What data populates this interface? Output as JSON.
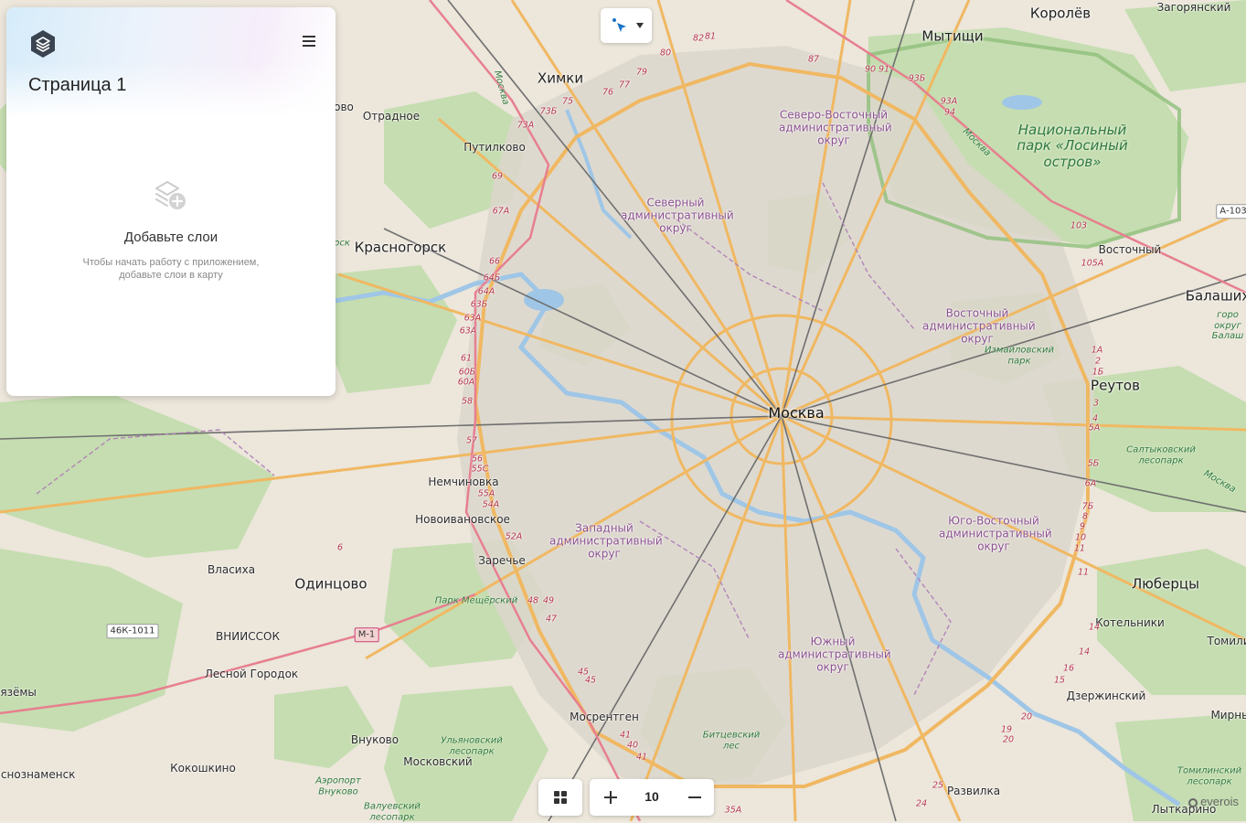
{
  "panel": {
    "page_title": "Страница 1",
    "empty_title": "Добавьте слои",
    "empty_desc": "Чтобы начать работу с приложением, добавьте слои в карту",
    "menu_icon": "hamburger-menu-icon",
    "logo_icon": "layers-logo-icon"
  },
  "tool": {
    "icon": "select-pointer-icon",
    "caret_icon": "caret-down-icon"
  },
  "zoom": {
    "level": "10"
  },
  "attribution": "everois",
  "map_labels": {
    "korolev": "Королёв",
    "zagoryansky": "Загорянский",
    "mytishchi": "Мытищи",
    "khimki": "Химки",
    "otradnoe": "Отрадное",
    "putilkovo": "Путилково",
    "krasnogorsk": "Красногорск",
    "vostochny": "Восточный",
    "balashikha": "Балаших",
    "reutov": "Реутов",
    "moskva": "Москва",
    "nemchinovka": "Немчиновка",
    "novoivanovskoe": "Новоивановское",
    "zarechye": "Заречье",
    "vlasikha": "Власиха",
    "odintsovo": "Одинцово",
    "lyubertsy": "Люберцы",
    "kotelniki": "Котельники",
    "tomilino": "Томили",
    "vniissok": "ВНИИССОК",
    "lesnoy_gorodok": "Лесной Городок",
    "vyazyomy": "Вязёмы",
    "mosrentgen": "Мосрентген",
    "vnukovo": "Внуково",
    "moskovsky": "Московский",
    "kokoshkino": "Кокошкино",
    "krasnoznamensk": "аснознаменск",
    "dzerzhinsky": "Дзержинский",
    "mirny": "Мирны",
    "razvilka": "Развилка",
    "lytkarino": "Лыткарино",
    "oboro": "ово",
    "d_sv": "Северо-Восточный административный округ",
    "d_sev": "Северный административный округ",
    "d_vost": "Восточный административный округ",
    "d_zap": "Западный административный округ",
    "d_uv": "Юго-Восточный административный округ",
    "d_yuzh": "Южный административный округ",
    "p_losiny": "Национальный парк «Лосиный остров»",
    "p_izmailovo": "Измайловский парк",
    "p_saltykovsky": "Салтыковский лесопарк",
    "p_meshchersky": "Парк Мещёрский",
    "p_bitsevsky": "Битцевский лес",
    "p_ulyanovsky": "Ульяновский лесопарк",
    "p_tomilinsky": "Томилинский лесопарк",
    "p_valuevsky": "Валуевский лесопарк",
    "p_gorod_balashikha": "горо округ Балаш",
    "airport": "Аэропорт Внуково",
    "mosk_river_1": "Москва",
    "mosk_river_2": "Москва",
    "mosk_river_3": "Москва",
    "r_rsk": "рск",
    "sh_a103": "А-103",
    "sh_46k": "46К-1011",
    "sh_m1": "М-1",
    "km_82": "82",
    "km_81": "81",
    "km_80": "80",
    "km_79": "79",
    "km_77": "77",
    "km_76": "76",
    "km_75": "75",
    "km_73b": "73Б",
    "km_73a": "73А",
    "km_69": "69",
    "km_67a": "67А",
    "km_66": "66",
    "km_64b": "64Б",
    "km_64a": "64А",
    "km_63b": "63Б",
    "km_63a1": "63А",
    "km_63a2": "63А",
    "km_61": "61",
    "km_60b": "60Б",
    "km_60a": "60А",
    "km_58": "58",
    "km_57": "57",
    "km_56": "56",
    "km_55s": "55С",
    "km_55a": "55А",
    "km_54a": "54А",
    "km_52a": "52А",
    "km_48": "48",
    "km_49": "49",
    "km_47": "47",
    "km_45a": "45",
    "km_45b": "45",
    "km_41a": "41",
    "km_40": "40",
    "km_41b": "41",
    "km_35a": "35А",
    "km_87": "87",
    "km_90": "90",
    "km_91": "91",
    "km_93b": "93Б",
    "km_93a": "93А",
    "km_94": "94",
    "km_103": "103",
    "km_105a": "105А",
    "km_1a": "1А",
    "km_2": "2",
    "km_1b": "1Б",
    "km_3": "3",
    "km_4": "4",
    "km_5a": "5А",
    "km_5b": "5Б",
    "km_6a": "6А",
    "km_7b": "7Б",
    "km_8": "8",
    "km_9": "9",
    "km_10": "10",
    "km_11a": "11",
    "km_11b": "11",
    "km_14a": "14",
    "km_14b": "14",
    "km_16": "16",
    "km_15": "15",
    "km_20a": "20",
    "km_19": "19",
    "km_20b": "20",
    "km_25": "25",
    "km_24": "24",
    "km_6": "6"
  }
}
